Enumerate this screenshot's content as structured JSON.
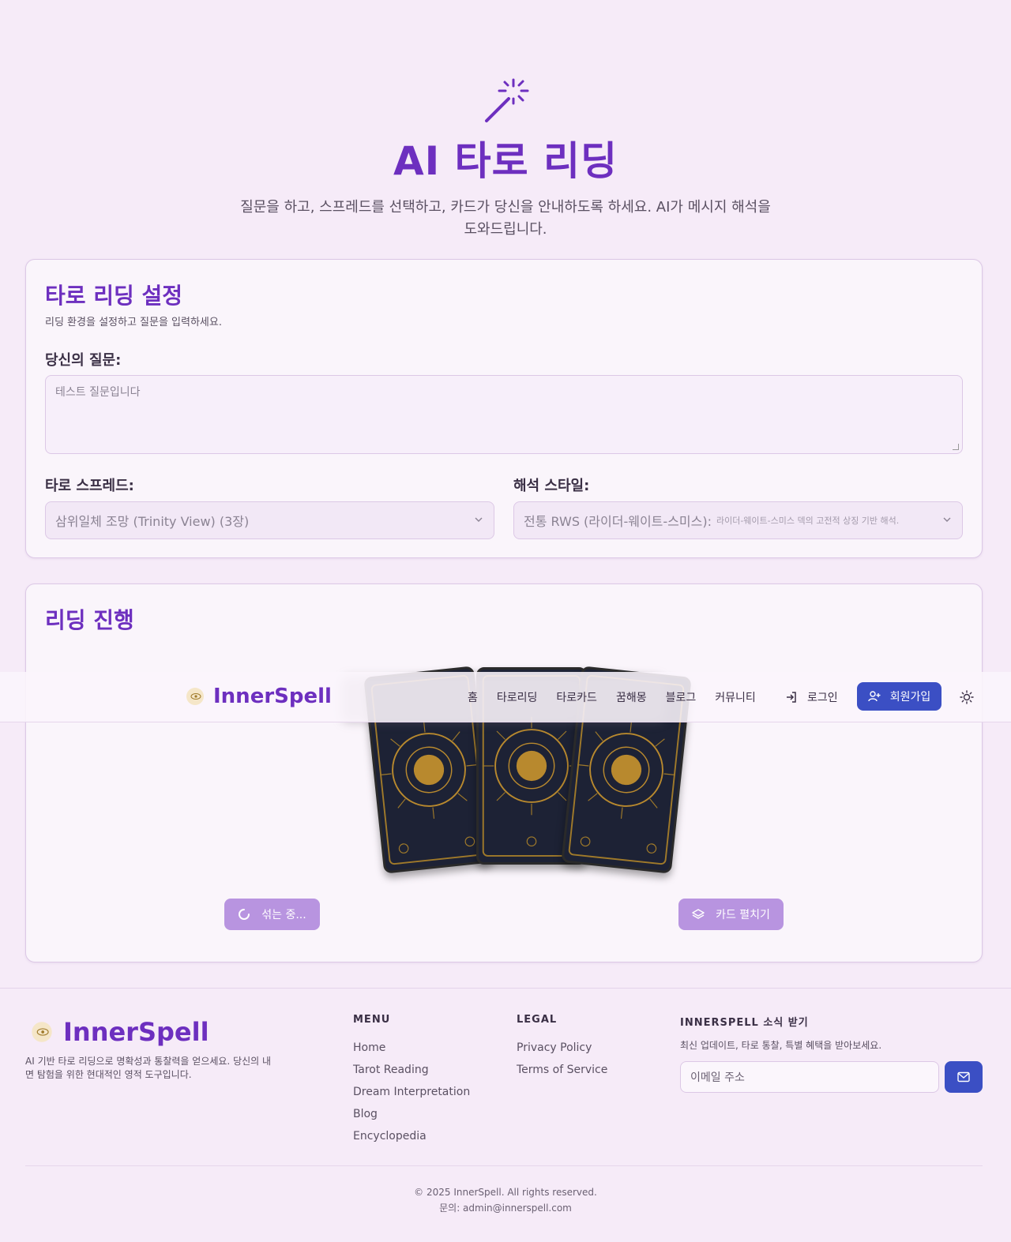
{
  "hero": {
    "title": "AI 타로 리딩",
    "subtitle": "질문을 하고, 스프레드를 선택하고, 카드가 당신을 안내하도록 하세요. AI가 메시지 해석을 도와드립니다."
  },
  "setup": {
    "title": "타로 리딩 설정",
    "subtitle": "리딩 환경을 설정하고 질문을 입력하세요.",
    "question_label": "당신의 질문:",
    "question_placeholder": "테스트 질문입니다",
    "spread_label": "타로 스프레드:",
    "spread_value": "삼위일체 조망 (Trinity View) (3장)",
    "style_label": "해석 스타일:",
    "style_value": "전통 RWS (라이더-웨이트-스미스):",
    "style_desc": "라이더-웨이트-스미스 덱의 고전적 상징 기반 해석."
  },
  "reading": {
    "title": "리딩 진행",
    "shuffle_label": "섞는 중...",
    "spread_button_label": "카드 펼치기"
  },
  "nav": {
    "brand": "InnerSpell",
    "links": [
      "홈",
      "타로리딩",
      "타로카드",
      "꿈해몽",
      "블로그",
      "커뮤니티"
    ],
    "login": "로그인",
    "signup": "회원가입"
  },
  "footer": {
    "brand": "InnerSpell",
    "description": "AI 기반 타로 리딩으로 명확성과 통찰력을 얻으세요. 당신의 내면 탐험을 위한 현대적인 영적 도구입니다.",
    "menu_title": "MENU",
    "menu": [
      "Home",
      "Tarot Reading",
      "Dream Interpretation",
      "Blog",
      "Encyclopedia"
    ],
    "legal_title": "LEGAL",
    "legal": [
      "Privacy Policy",
      "Terms of Service"
    ],
    "news_title": "INNERSPELL 소식 받기",
    "news_desc": "최신 업데이트, 타로 통찰, 특별 혜택을 받아보세요.",
    "email_placeholder": "이메일 주소",
    "copyright": "© 2025 InnerSpell. All rights reserved.",
    "contact": "문의: admin@innerspell.com"
  },
  "colors": {
    "accent": "#6d2fbf",
    "primary_button": "#3b4fc4",
    "disabled_button": "#b894e0",
    "background": "#f6ebf8"
  }
}
